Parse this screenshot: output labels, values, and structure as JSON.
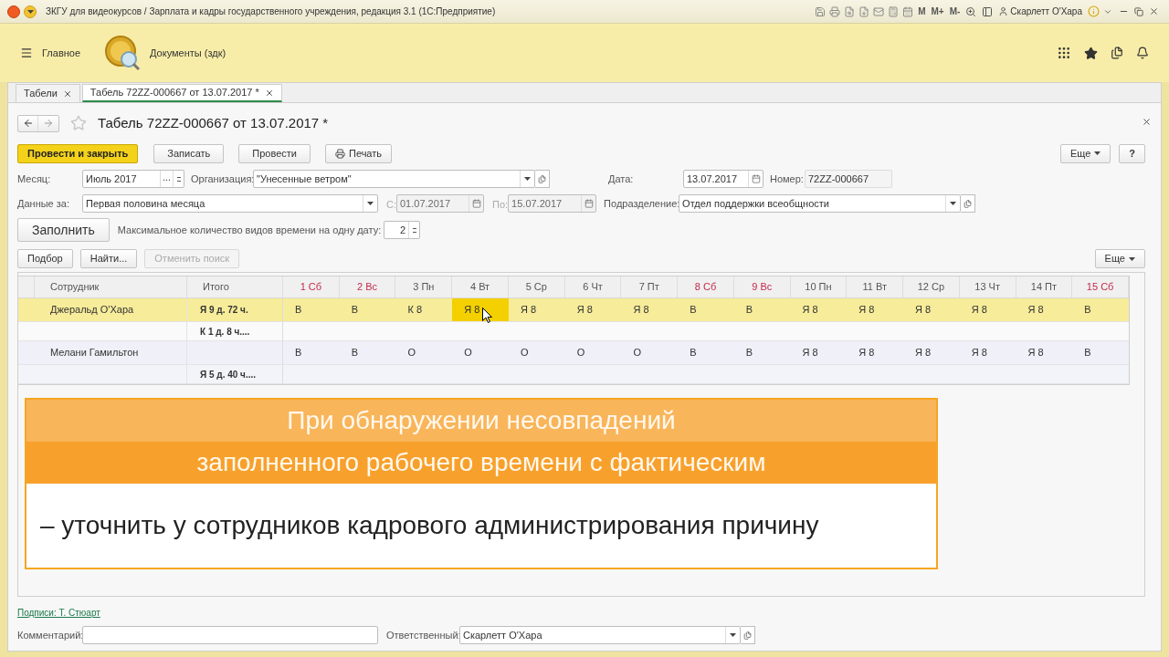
{
  "title_bar": {
    "title": "ЗКГУ для видеокурсов / Зарплата и кадры государственного учреждения, редакция 3.1  (1С:Предприятие)",
    "memory_buttons": [
      "M",
      "M+",
      "M-"
    ],
    "user": "Скарлетт О'Хара"
  },
  "top_panel": {
    "menu": "Главное",
    "section": "Документы (здк)"
  },
  "tabs": [
    {
      "label": "Табели",
      "selected": false
    },
    {
      "label": "Табель 72ZZ-000667 от 13.07.2017 *",
      "selected": true
    }
  ],
  "form": {
    "title": "Табель 72ZZ-000667 от 13.07.2017 *",
    "commands": [
      {
        "label": "Провести и закрыть",
        "kind": "primary"
      },
      {
        "label": "Записать",
        "kind": "plain"
      },
      {
        "label": "Провести",
        "kind": "plain"
      },
      {
        "label": "Печать",
        "kind": "print"
      }
    ],
    "more": "Еще",
    "help": "?",
    "month": {
      "label": "Месяц:",
      "value": "Июль 2017",
      "choose": "..."
    },
    "organization": {
      "label": "Организация:",
      "value": "\"Унесенные ветром\""
    },
    "date": {
      "label": "Дата:",
      "value": "13.07.2017"
    },
    "number": {
      "label": "Номер:",
      "value": "72ZZ-000667"
    },
    "period": {
      "label": "Данные за:",
      "value": "Первая половина  месяца"
    },
    "from": {
      "label": "С:",
      "value": "01.07.2017",
      "disabled": true
    },
    "to": {
      "label": "По:",
      "value": "15.07.2017",
      "disabled": true
    },
    "department": {
      "label": "Подразделение:",
      "value": "Отдел поддержки всеобщности"
    },
    "fill_button": "Заполнить",
    "max_kinds": {
      "label": "Максимальное количество видов времени на одну дату:",
      "value": "2"
    }
  },
  "table": {
    "toolbar": [
      {
        "label": "Подбор",
        "disabled": false
      },
      {
        "label": "Найти...",
        "disabled": false
      },
      {
        "label": "Отменить поиск",
        "disabled": true
      }
    ],
    "more": "Еще",
    "columns": [
      {
        "label": "Сотрудник",
        "weekend": false
      },
      {
        "label": "Итого",
        "weekend": false
      },
      {
        "label": "1 Сб",
        "weekend": true
      },
      {
        "label": "2 Вс",
        "weekend": true
      },
      {
        "label": "3 Пн",
        "weekend": false
      },
      {
        "label": "4 Вт",
        "weekend": false
      },
      {
        "label": "5 Ср",
        "weekend": false
      },
      {
        "label": "6 Чт",
        "weekend": false
      },
      {
        "label": "7 Пт",
        "weekend": false
      },
      {
        "label": "8 Сб",
        "weekend": true
      },
      {
        "label": "9 Вс",
        "weekend": true
      },
      {
        "label": "10 Пн",
        "weekend": false
      },
      {
        "label": "11 Вт",
        "weekend": false
      },
      {
        "label": "12 Ср",
        "weekend": false
      },
      {
        "label": "13 Чт",
        "weekend": false
      },
      {
        "label": "14 Пт",
        "weekend": false
      },
      {
        "label": "15 Сб",
        "weekend": true
      }
    ],
    "rows": [
      {
        "employee": "Джеральд О'Хара",
        "total": "Я 9 д. 72 ч.",
        "selected": true,
        "days": [
          {
            "text": "В",
            "selected": false
          },
          {
            "text": "В",
            "selected": false
          },
          {
            "text": "К 8",
            "selected": false
          },
          {
            "text": "Я 8",
            "selected": true
          },
          {
            "text": "Я 8",
            "selected": false
          },
          {
            "text": "Я 8",
            "selected": false
          },
          {
            "text": "Я 8",
            "selected": false
          },
          {
            "text": "В",
            "selected": false
          },
          {
            "text": "В",
            "selected": false
          },
          {
            "text": "Я 8",
            "selected": false
          },
          {
            "text": "Я 8",
            "selected": false
          },
          {
            "text": "Я 8",
            "selected": false
          },
          {
            "text": "Я 8",
            "selected": false
          },
          {
            "text": "Я 8",
            "selected": false
          },
          {
            "text": "В",
            "selected": false
          }
        ]
      },
      {
        "total": "К 1 д. 8 ч....",
        "selected": false
      },
      {
        "employee": "Мелани Гамильтон",
        "selected": false,
        "days": [
          {
            "text": "В",
            "selected": false
          },
          {
            "text": "В",
            "selected": false
          },
          {
            "text": "О",
            "selected": false
          },
          {
            "text": "О",
            "selected": false
          },
          {
            "text": "О",
            "selected": false
          },
          {
            "text": "О",
            "selected": false
          },
          {
            "text": "О",
            "selected": false
          },
          {
            "text": "В",
            "selected": false
          },
          {
            "text": "В",
            "selected": false
          },
          {
            "text": "Я 8",
            "selected": false
          },
          {
            "text": "Я 8",
            "selected": false
          },
          {
            "text": "Я 8",
            "selected": false
          },
          {
            "text": "Я 8",
            "selected": false
          },
          {
            "text": "Я 8",
            "selected": false
          },
          {
            "text": "В",
            "selected": false
          }
        ]
      },
      {
        "total": "Я 5 д. 40 ч....",
        "selected": false
      }
    ]
  },
  "banner": {
    "heading_lines": [
      "При обнаружении несовпадений",
      "заполненного рабочего времени с фактическим"
    ],
    "text": "– уточнить у сотрудников кадрового администрирования причину"
  },
  "footer": {
    "signatures": "Подписи: Т. Стюарт",
    "comment": {
      "label": "Комментарий:"
    },
    "responsible": {
      "label": "Ответственный:",
      "value": "Скарлетт О'Хара"
    }
  }
}
